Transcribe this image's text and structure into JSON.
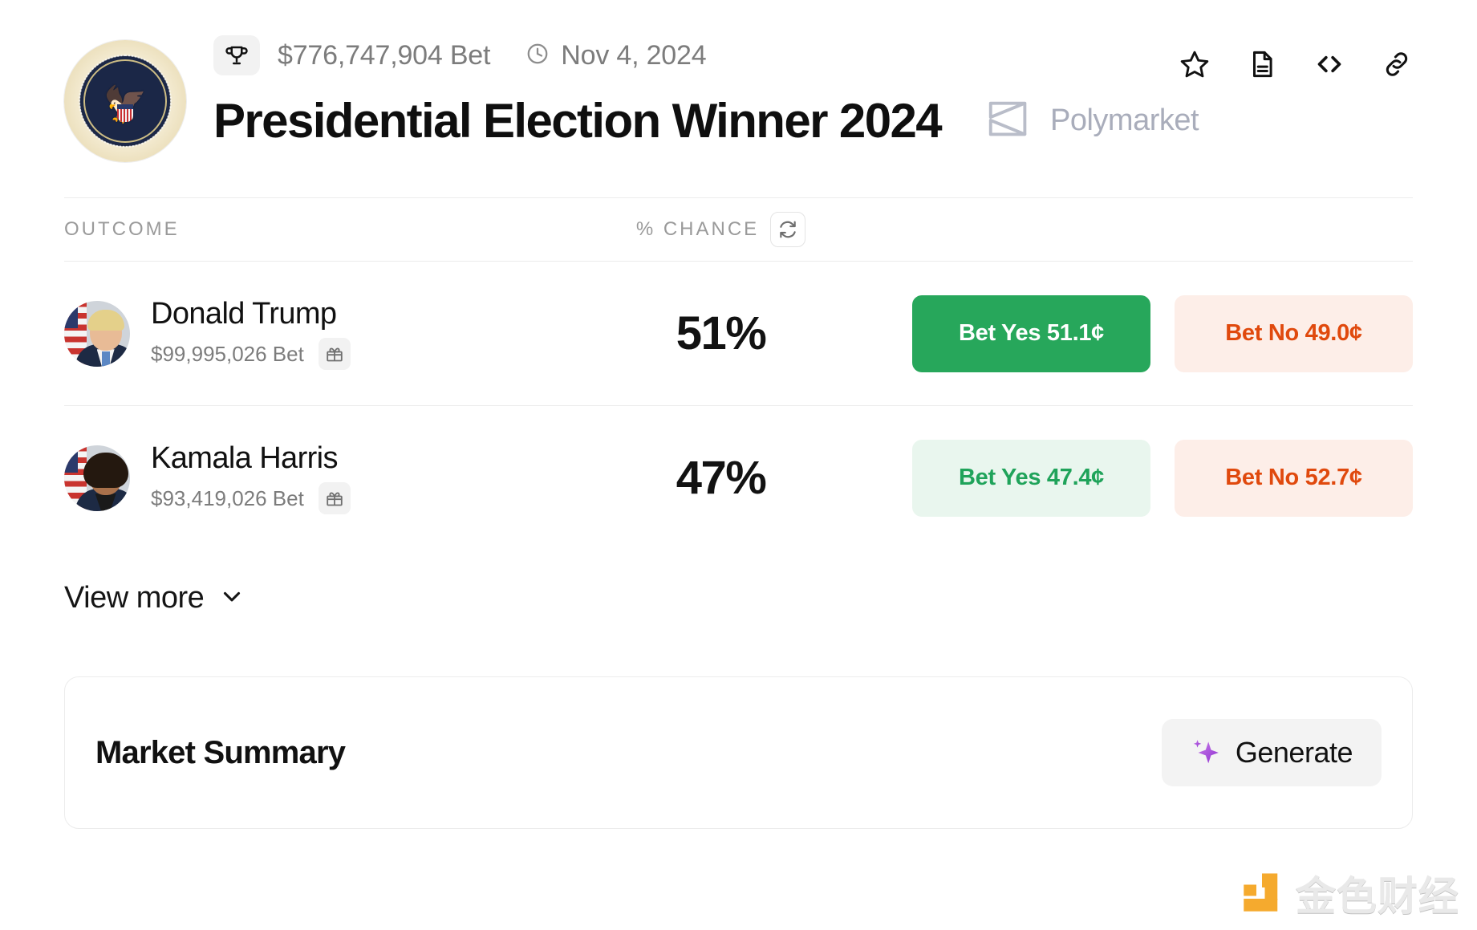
{
  "header": {
    "trophy_icon": "trophy-icon",
    "volume": "$776,747,904 Bet",
    "clock_icon": "clock-icon",
    "date": "Nov 4, 2024",
    "title": "Presidential Election Winner 2024",
    "brand": "Polymarket",
    "seal_alt": "Seal of the President of the United States",
    "actions": [
      {
        "name": "star-icon",
        "label": "Favorite"
      },
      {
        "name": "document-icon",
        "label": "Rules"
      },
      {
        "name": "code-icon",
        "label": "Embed"
      },
      {
        "name": "link-icon",
        "label": "Copy link"
      }
    ]
  },
  "table": {
    "columns": {
      "outcome": "OUTCOME",
      "chance": "% CHANCE",
      "refresh_icon": "refresh-icon"
    },
    "rows": [
      {
        "name": "Donald Trump",
        "volume": "$99,995,026 Bet",
        "gift_icon": "gift-icon",
        "chance": "51%",
        "yes_label": "Bet Yes 51.1¢",
        "no_label": "Bet No 49.0¢",
        "yes_style": "strong"
      },
      {
        "name": "Kamala Harris",
        "volume": "$93,419,026 Bet",
        "gift_icon": "gift-icon",
        "chance": "47%",
        "yes_label": "Bet Yes 47.4¢",
        "no_label": "Bet No 52.7¢",
        "yes_style": "soft"
      }
    ]
  },
  "view_more": {
    "label": "View more",
    "chevron_icon": "chevron-down-icon"
  },
  "summary": {
    "title": "Market Summary",
    "generate_label": "Generate",
    "sparkle_icon": "sparkle-icon"
  },
  "watermark": {
    "text": "金色财经"
  },
  "colors": {
    "yes_strong_bg": "#27a75b",
    "yes_soft_bg": "#e9f6ee",
    "yes_soft_text": "#1fa35a",
    "no_soft_bg": "#fdeee8",
    "no_soft_text": "#e0490d",
    "muted_text": "#7c7c7c",
    "brand_gray": "#a9adbb",
    "sparkle_purple": "#a23fd8",
    "watermark_orange": "#f5a623"
  }
}
